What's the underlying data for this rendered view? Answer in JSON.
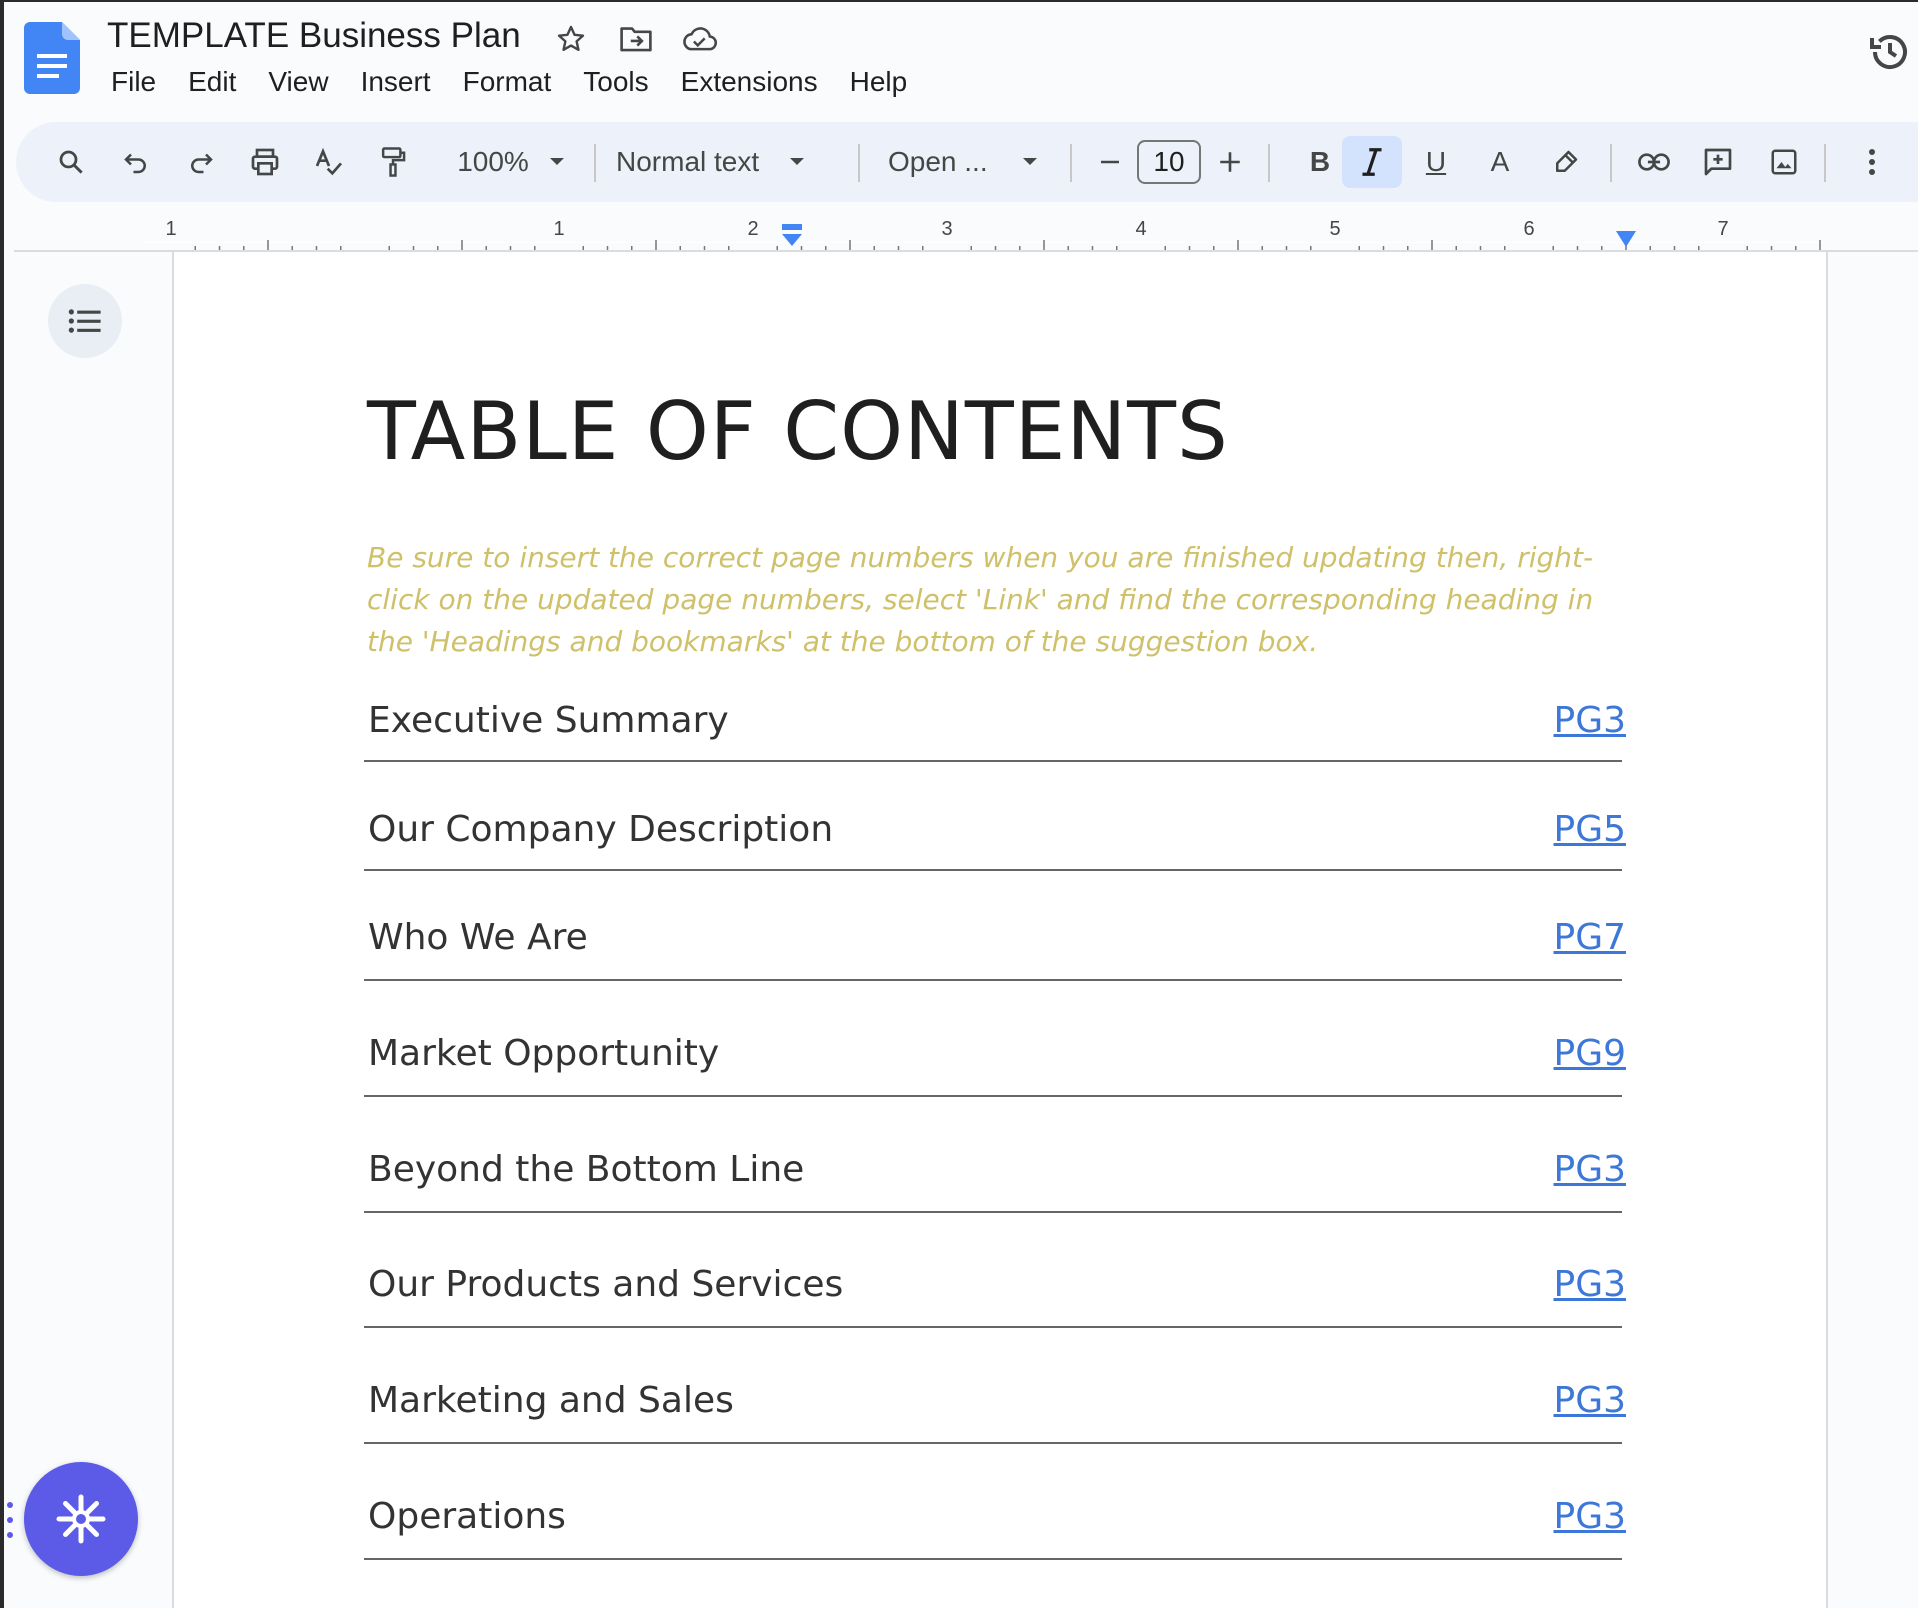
{
  "app": {
    "title": "TEMPLATE Business Plan",
    "brand_color": "#4285f4"
  },
  "menu": [
    "File",
    "Edit",
    "View",
    "Insert",
    "Format",
    "Tools",
    "Extensions",
    "Help"
  ],
  "toolbar": {
    "zoom": "100%",
    "style": "Normal text",
    "font": "Open ...",
    "font_size": "10",
    "bold_label": "B",
    "underline_label": "U",
    "text_color_label": "A",
    "italic_active": true
  },
  "ruler": {
    "labels": [
      "1",
      "1",
      "2",
      "3",
      "4",
      "5",
      "6",
      "7"
    ]
  },
  "document": {
    "heading": "TABLE OF CONTENTS",
    "note": "Be sure to insert the correct page numbers when you are finished updating then, right-click on the updated page numbers, select 'Link' and find the corresponding heading in the 'Headings and bookmarks' at the bottom of the suggestion box.",
    "note_color": "#cfc06a",
    "link_color": "#3d78d8",
    "toc": [
      {
        "label": "Executive Summary",
        "page": "PG3"
      },
      {
        "label": "Our Company Description",
        "page": "PG5"
      },
      {
        "label": "Who We Are",
        "page": "PG7"
      },
      {
        "label": "Market Opportunity",
        "page": "PG9"
      },
      {
        "label": "Beyond the Bottom Line",
        "page": "PG3"
      },
      {
        "label": "Our Products and Services",
        "page": "PG3"
      },
      {
        "label": "Marketing and Sales",
        "page": "PG3"
      },
      {
        "label": "Operations",
        "page": "PG3"
      }
    ]
  }
}
